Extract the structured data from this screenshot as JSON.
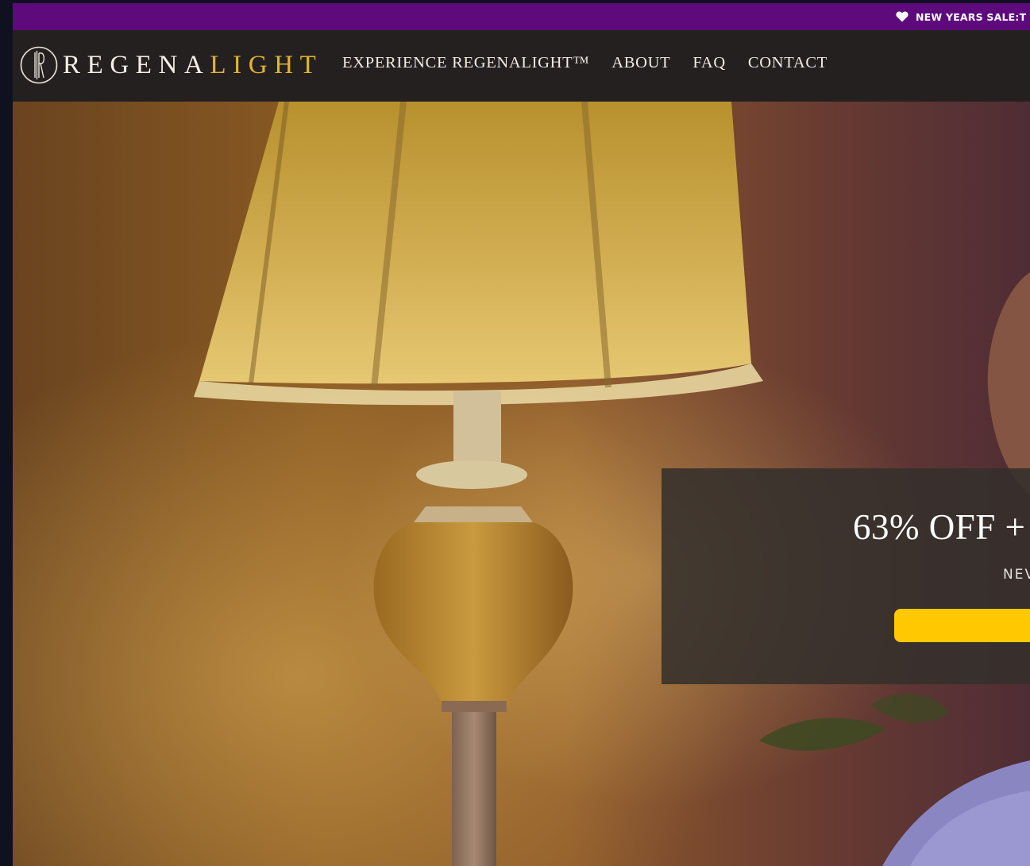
{
  "announcement": {
    "text": "NEW YEARS SALE:T",
    "icon": "heart-icon",
    "background": "#5e0a7c"
  },
  "header": {
    "logo": {
      "part_white": "REGENA",
      "part_gold": "LIGHT",
      "gold_color": "#e3b42c"
    },
    "nav": [
      {
        "label": "EXPERIENCE REGENALIGHT™"
      },
      {
        "label": "ABOUT"
      },
      {
        "label": "FAQ"
      },
      {
        "label": "CONTACT"
      }
    ]
  },
  "hero": {
    "promo": {
      "title": "63% OFF +",
      "subtitle": "NEV",
      "button_color": "#ffc800"
    }
  }
}
